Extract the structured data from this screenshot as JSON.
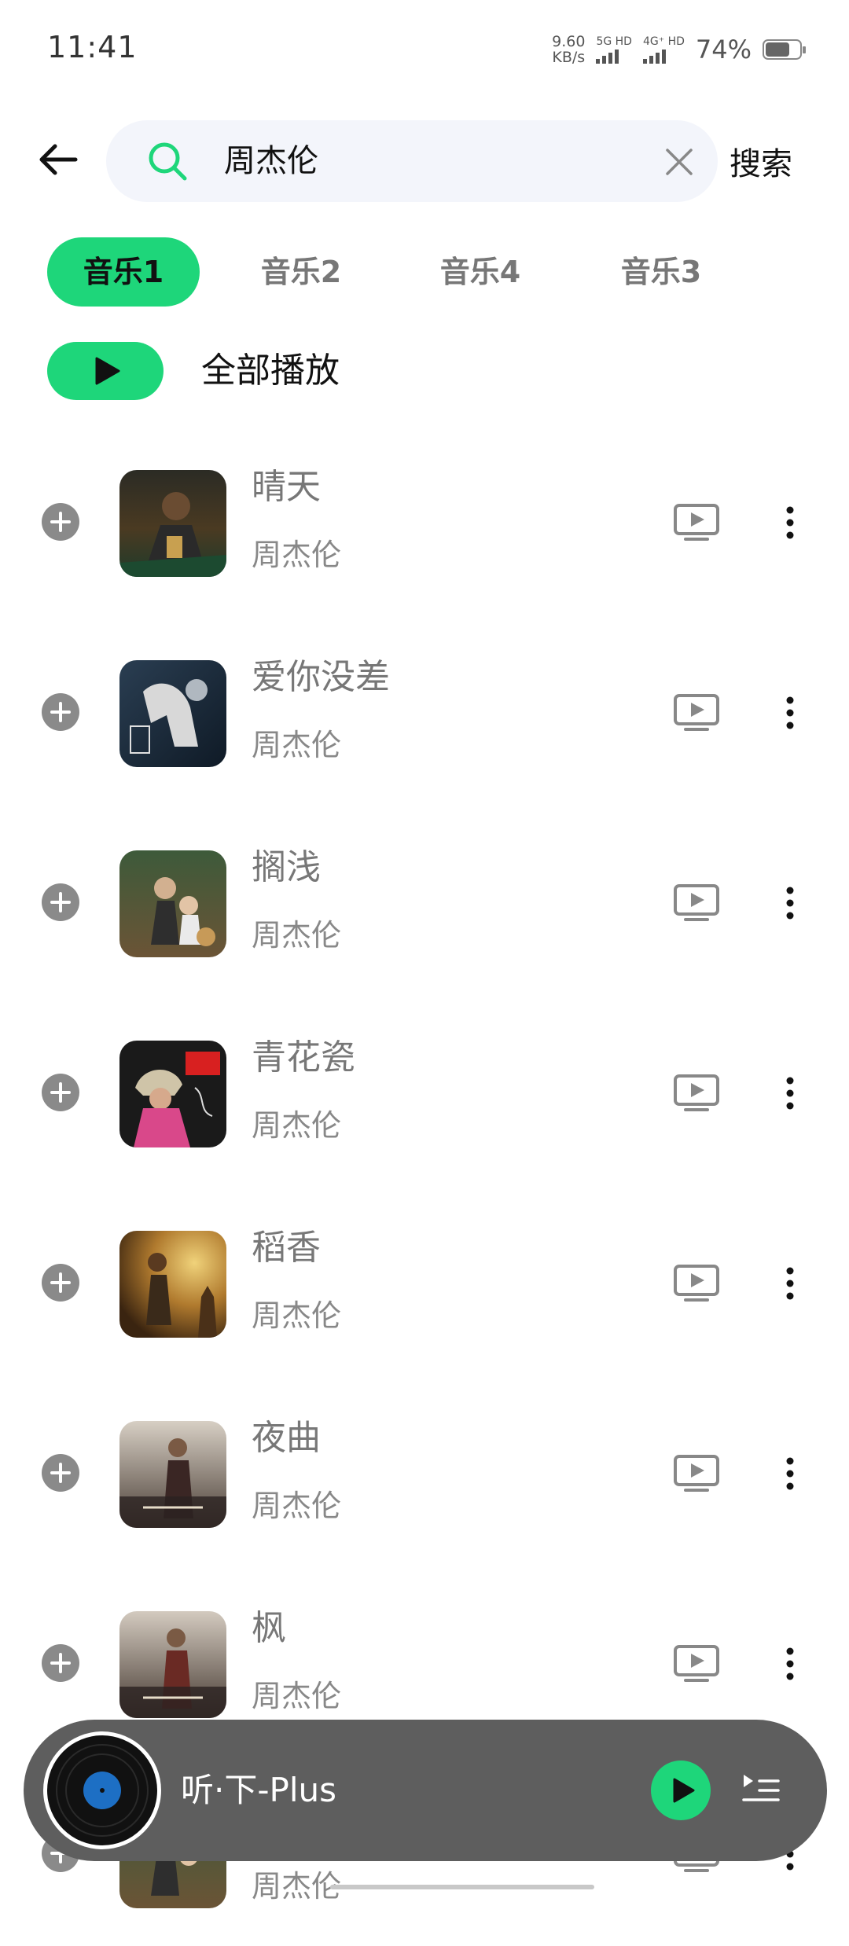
{
  "status_bar": {
    "time": "11:41",
    "net_speed_value": "9.60",
    "net_speed_unit": "KB/s",
    "sim1_label": "5G HD",
    "sim2_label": "4G⁺ HD",
    "battery_percent": "74%",
    "battery_level": 0.74
  },
  "search": {
    "query": "周杰伦",
    "button_label": "搜索"
  },
  "tabs": [
    {
      "label": "音乐1",
      "active": true
    },
    {
      "label": "音乐2",
      "active": false
    },
    {
      "label": "音乐4",
      "active": false
    },
    {
      "label": "音乐3",
      "active": false
    }
  ],
  "play_all_label": "全部播放",
  "songs": [
    {
      "title": "晴天",
      "artist": "周杰伦"
    },
    {
      "title": "爱你没差",
      "artist": "周杰伦"
    },
    {
      "title": "搁浅",
      "artist": "周杰伦"
    },
    {
      "title": "青花瓷",
      "artist": "周杰伦"
    },
    {
      "title": "稻香",
      "artist": "周杰伦"
    },
    {
      "title": "夜曲",
      "artist": "周杰伦"
    },
    {
      "title": "枫",
      "artist": "周杰伦"
    },
    {
      "title": "",
      "artist": "周杰伦"
    }
  ],
  "player": {
    "title": "听·下-Plus"
  },
  "colors": {
    "accent": "#1ed67a",
    "player_bg": "#5e5e5e"
  }
}
